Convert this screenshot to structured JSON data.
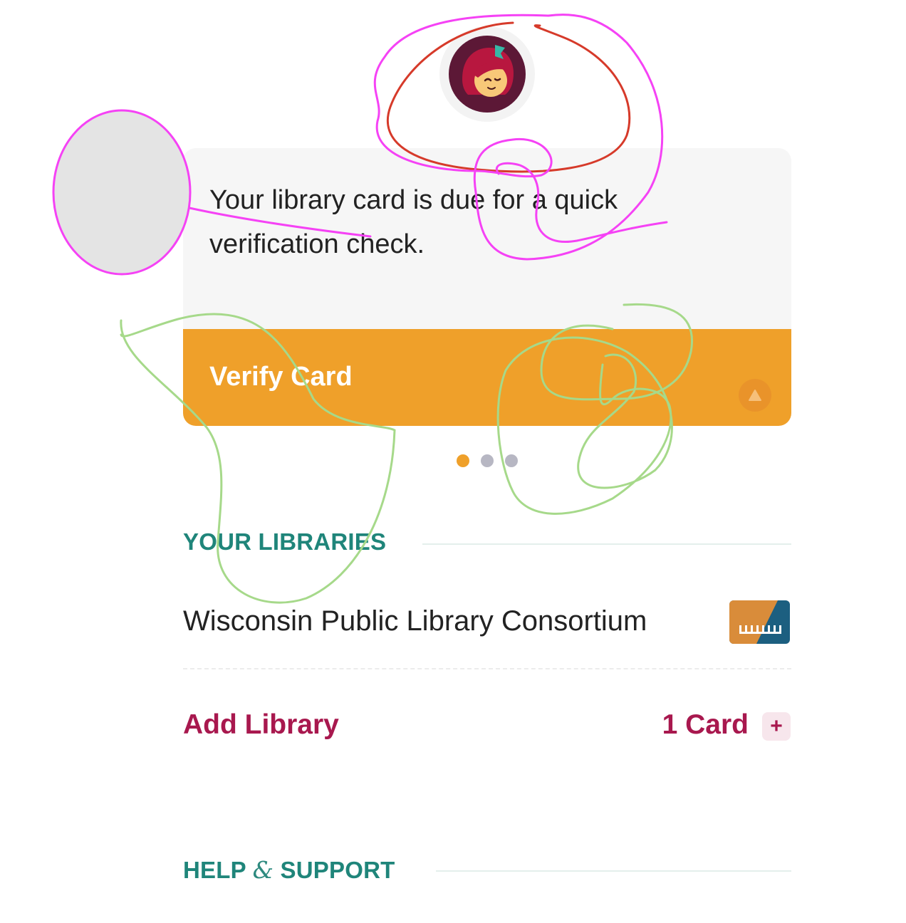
{
  "app": {
    "logo_icon": "libby-logo-icon"
  },
  "verify_card": {
    "message": "Your library card is due for a quick verification check.",
    "button_label": "Verify Card",
    "caret_icon": "caret-up-icon",
    "pager": {
      "total": 3,
      "active_index": 0
    }
  },
  "libraries_section": {
    "heading": "YOUR LIBRARIES",
    "libraries": [
      {
        "name": "Wisconsin Public Library Consortium",
        "icon": "library-card-icon"
      }
    ],
    "add_library_label": "Add Library",
    "card_count_label": "1 Card",
    "plus_label": "+"
  },
  "help_section": {
    "heading_part1": "HELP ",
    "heading_amp": "&",
    "heading_part2": " SUPPORT"
  },
  "colors": {
    "accent_orange": "#efa02a",
    "teal_heading": "#1f857a",
    "brand_maroon": "#a8184e",
    "annotation_magenta": "#f542f5",
    "annotation_red": "#d63a2a",
    "annotation_green": "#a6d98a"
  }
}
